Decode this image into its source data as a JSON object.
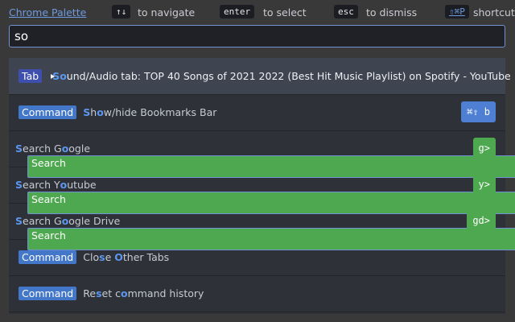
{
  "topbar": {
    "brand": "Chrome Palette",
    "navigate_key": "↑↓",
    "navigate_hint": "to navigate",
    "select_key": "enter",
    "select_hint": "to select",
    "dismiss_key": "esc",
    "dismiss_hint": "to dismiss",
    "shortcut_key": "⇧⌘P",
    "shortcut_hint": "shortcut"
  },
  "search": {
    "value": "so"
  },
  "results": [
    {
      "badge": "Tab",
      "type": "tab",
      "icon": "youtube-icon",
      "parts": [
        {
          "t": "S",
          "h": 1
        },
        {
          "t": "o",
          "h": 1
        },
        {
          "t": "und/Audio tab: TOP 40 Songs of 2021 2022 (Best Hit Music Playlist) on Spotify - YouTube",
          "h": 0
        }
      ],
      "shortcut": ""
    },
    {
      "badge": "Command",
      "type": "cmd",
      "parts": [
        {
          "t": "S",
          "h": 1
        },
        {
          "t": "h",
          "h": 0
        },
        {
          "t": "o",
          "h": 1
        },
        {
          "t": "w/hide Bookmarks Bar",
          "h": 0
        }
      ],
      "shortcut": "⌘⇧ b",
      "shortcut_color": "blue"
    },
    {
      "badge": "Search",
      "type": "search",
      "parts": [
        {
          "t": "S",
          "h": 1
        },
        {
          "t": "earch G",
          "h": 0
        },
        {
          "t": "o",
          "h": 1
        },
        {
          "t": "ogle",
          "h": 0
        }
      ],
      "shortcut": "g>",
      "shortcut_color": "green"
    },
    {
      "badge": "Search",
      "type": "search",
      "parts": [
        {
          "t": "S",
          "h": 1
        },
        {
          "t": "earch Y",
          "h": 0
        },
        {
          "t": "o",
          "h": 1
        },
        {
          "t": "utube",
          "h": 0
        }
      ],
      "shortcut": "y>",
      "shortcut_color": "green"
    },
    {
      "badge": "Search",
      "type": "search",
      "parts": [
        {
          "t": "S",
          "h": 1
        },
        {
          "t": "earch G",
          "h": 0
        },
        {
          "t": "o",
          "h": 1
        },
        {
          "t": "ogle Drive",
          "h": 0
        }
      ],
      "shortcut": "gd>",
      "shortcut_color": "green"
    },
    {
      "badge": "Command",
      "type": "cmd",
      "parts": [
        {
          "t": "Clo",
          "h": 0
        },
        {
          "t": "s",
          "h": 1
        },
        {
          "t": "e ",
          "h": 0
        },
        {
          "t": "O",
          "h": 1
        },
        {
          "t": "ther Tabs",
          "h": 0
        }
      ],
      "shortcut": ""
    },
    {
      "badge": "Command",
      "type": "cmd",
      "parts": [
        {
          "t": "Re",
          "h": 0
        },
        {
          "t": "s",
          "h": 1
        },
        {
          "t": "et c",
          "h": 0
        },
        {
          "t": "o",
          "h": 1
        },
        {
          "t": "mmand history",
          "h": 0
        }
      ],
      "shortcut": ""
    }
  ],
  "colors": {
    "accent": "#5b97f0",
    "tab_badge": "#3f4fae",
    "command_badge": "#4377c9",
    "search_badge": "#4ea84f"
  }
}
